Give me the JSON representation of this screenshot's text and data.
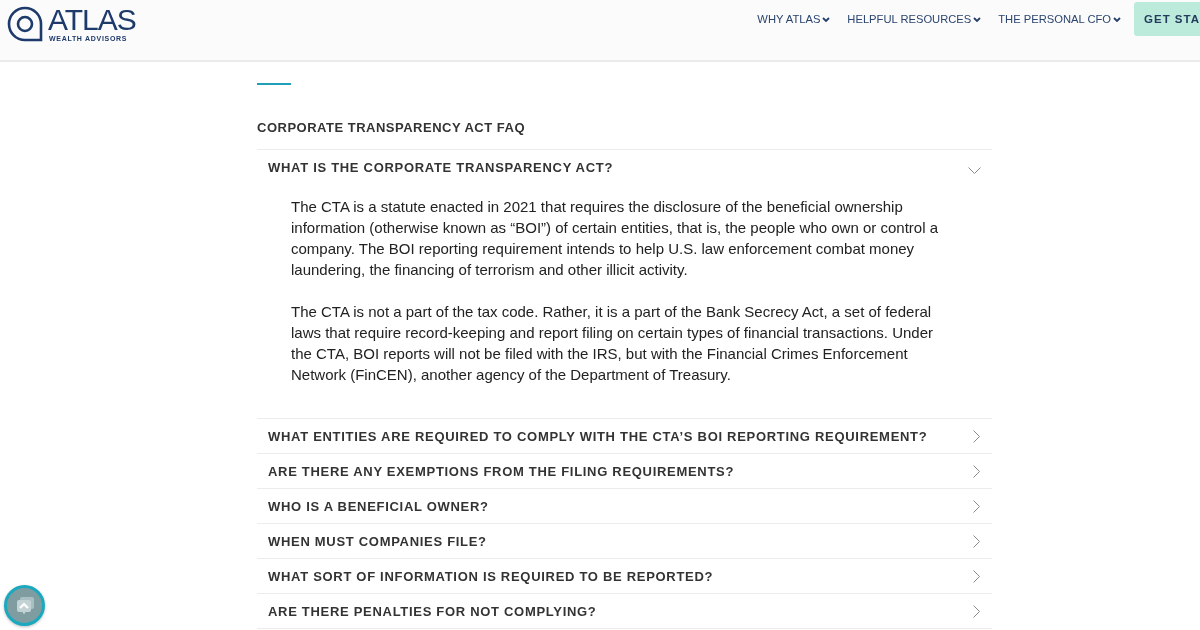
{
  "header": {
    "logo": {
      "name": "ATLAS",
      "tagline": "WEALTH ADVISORS"
    },
    "nav": [
      {
        "label": "WHY ATLAS"
      },
      {
        "label": "HELPFUL RESOURCES"
      },
      {
        "label": "THE PERSONAL CFO"
      }
    ],
    "cta": "GET STA"
  },
  "faq": {
    "title": "CORPORATE TRANSPARENCY ACT FAQ",
    "items": [
      {
        "question": "WHAT IS THE CORPORATE TRANSPARENCY ACT?",
        "expanded": true,
        "answer": [
          "The CTA is a statute enacted in 2021 that requires the disclosure of the beneficial ownership information (otherwise known as “BOI”) of certain entities, that is, the people who own or control a company. The BOI reporting requirement intends to help U.S. law enforcement combat money laundering, the financing of terrorism and other illicit activity.",
          "The CTA is not a part of the tax code. Rather, it is a part of the Bank Secrecy Act, a set of federal laws that require record-keeping and report filing on certain types of financial transactions. Under the CTA, BOI reports will not be filed with the IRS, but with the Financial Crimes Enforcement Network (FinCEN), another agency of the Department of Treasury."
        ]
      },
      {
        "question": "WHAT ENTITIES ARE REQUIRED TO COMPLY WITH THE CTA’S BOI REPORTING REQUIREMENT?",
        "expanded": false
      },
      {
        "question": "ARE THERE ANY EXEMPTIONS FROM THE FILING REQUIREMENTS?",
        "expanded": false
      },
      {
        "question": "WHO IS A BENEFICIAL OWNER?",
        "expanded": false
      },
      {
        "question": "WHEN MUST COMPANIES FILE?",
        "expanded": false
      },
      {
        "question": "WHAT SORT OF INFORMATION IS REQUIRED TO BE REPORTED?",
        "expanded": false
      },
      {
        "question": "ARE THERE PENALTIES FOR NOT COMPLYING?",
        "expanded": false
      }
    ]
  }
}
